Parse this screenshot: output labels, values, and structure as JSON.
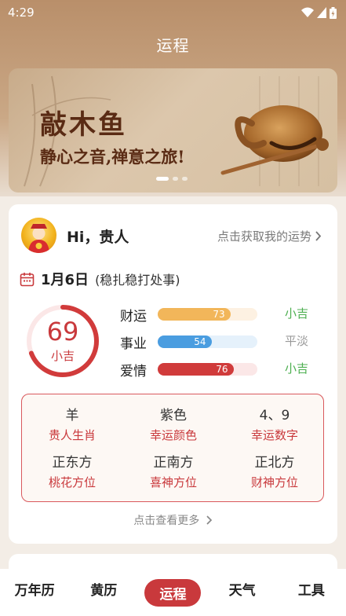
{
  "status_bar": {
    "time": "4:29"
  },
  "header": {
    "title": "运程"
  },
  "banner": {
    "title": "敲木鱼",
    "subtitle": "静心之音,禅意之旅!",
    "page_index": 0,
    "page_count": 3
  },
  "user": {
    "greeting": "Hi，贵人",
    "fortune_link": "点击获取我的运势"
  },
  "date": {
    "main": "1月6日",
    "note": "(稳扎稳打处事)"
  },
  "score": {
    "value": "69",
    "fraction": 0.69,
    "level": "小吉"
  },
  "metrics": [
    {
      "label": "财运",
      "value": "73",
      "fraction": 0.73,
      "level": "小吉",
      "color": "#f2b65a",
      "track": "#fdf1e2",
      "level_color": "#4caf50"
    },
    {
      "label": "事业",
      "value": "54",
      "fraction": 0.54,
      "level": "平淡",
      "color": "#4a9de0",
      "track": "#e5f1fb",
      "level_color": "#999999"
    },
    {
      "label": "爱情",
      "value": "76",
      "fraction": 0.76,
      "level": "小吉",
      "color": "#d03b3b",
      "track": "#fbe7e7",
      "level_color": "#4caf50"
    }
  ],
  "info": [
    {
      "value": "羊",
      "key": "贵人生肖"
    },
    {
      "value": "紫色",
      "key": "幸运颜色"
    },
    {
      "value": "4、9",
      "key": "幸运数字"
    },
    {
      "value": "正东方",
      "key": "桃花方位"
    },
    {
      "value": "正南方",
      "key": "喜神方位"
    },
    {
      "value": "正北方",
      "key": "财神方位"
    }
  ],
  "more_link": "点击查看更多",
  "tabs": [
    {
      "label": "万年历",
      "active": false
    },
    {
      "label": "黄历",
      "active": false
    },
    {
      "label": "运程",
      "active": true
    },
    {
      "label": "天气",
      "active": false
    },
    {
      "label": "工具",
      "active": false
    }
  ],
  "colors": {
    "accent": "#c9393c",
    "header_bg": "#b98f6a"
  }
}
